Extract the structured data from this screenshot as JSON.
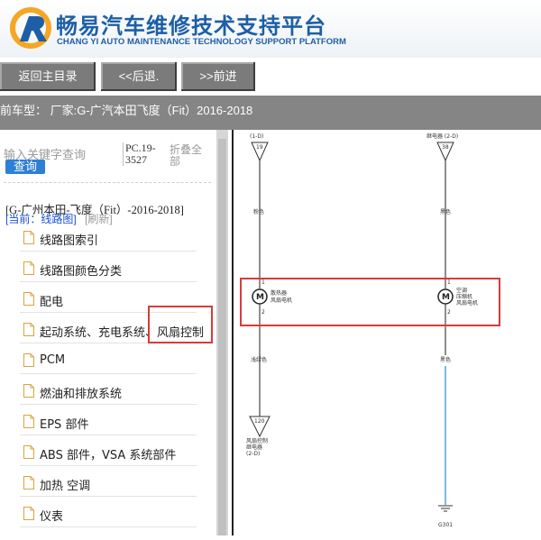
{
  "header": {
    "brand_cn": "畅易汽车维修技术支持平台",
    "brand_en": "CHANG YI AUTO MAINTENANCE TECHNOLOGY SUPPORT PLATFORM"
  },
  "toolbar": {
    "home_label": "返回主目录",
    "back_label": "<<后退.",
    "forward_label": ">>前进"
  },
  "carbar": {
    "text": "前车型： 厂家:G-广汽本田飞度（Fit）2016-2018"
  },
  "sidebar": {
    "search_placeholder": "输入关键字查询",
    "search_button": "查询",
    "pc_code": "PC.19-3527",
    "collapse_all": "折叠全部",
    "tree_root": "[G-广州本田-飞度（Fit）-2016-2018]",
    "current": "[当前：线路图]",
    "refresh": "[刷新]",
    "items": [
      {
        "label": "线路图索引"
      },
      {
        "label": "线路图颜色分类"
      },
      {
        "label": "配电"
      },
      {
        "label": "起动系统、充电系统、风扇控制"
      },
      {
        "label": "PCM"
      },
      {
        "label": "燃油和排放系统"
      },
      {
        "label": "EPS 部件"
      },
      {
        "label": "ABS 部件，VSA 系统部件"
      },
      {
        "label": "加热 空调"
      },
      {
        "label": "仪表"
      }
    ]
  },
  "diagram": {
    "left_top_ref": "(1-D)",
    "left_pin_top": "19",
    "left_wire_color_top": "粉色",
    "left_motor_pin1": "1",
    "left_motor_label_1": "散热器",
    "left_motor_label_2": "风扇电机",
    "left_motor_pin2": "2",
    "left_wire_color_bottom": "浅绿色",
    "left_pin_bottom": "120",
    "left_bottom_label_1": "风扇控制",
    "left_bottom_label_2": "继电器",
    "left_bottom_label_3": "(2-D)",
    "right_top_ref": "继电器 (2-D)",
    "right_pin_top": "38",
    "right_wire_color_top": "黑色",
    "right_motor_pin1": "1",
    "right_motor_label_1": "空调",
    "right_motor_label_2": "压缩机",
    "right_motor_label_3": "风扇电机",
    "right_motor_pin2": "2",
    "right_wire_color_bottom": "黑色",
    "ground_label": "G301"
  },
  "colors": {
    "brand_blue": "#1d5fa6",
    "button_gray": "#7b7b7b",
    "highlight_red": "#d93a3a",
    "ground_wire_blue": "#5fa8d3"
  }
}
